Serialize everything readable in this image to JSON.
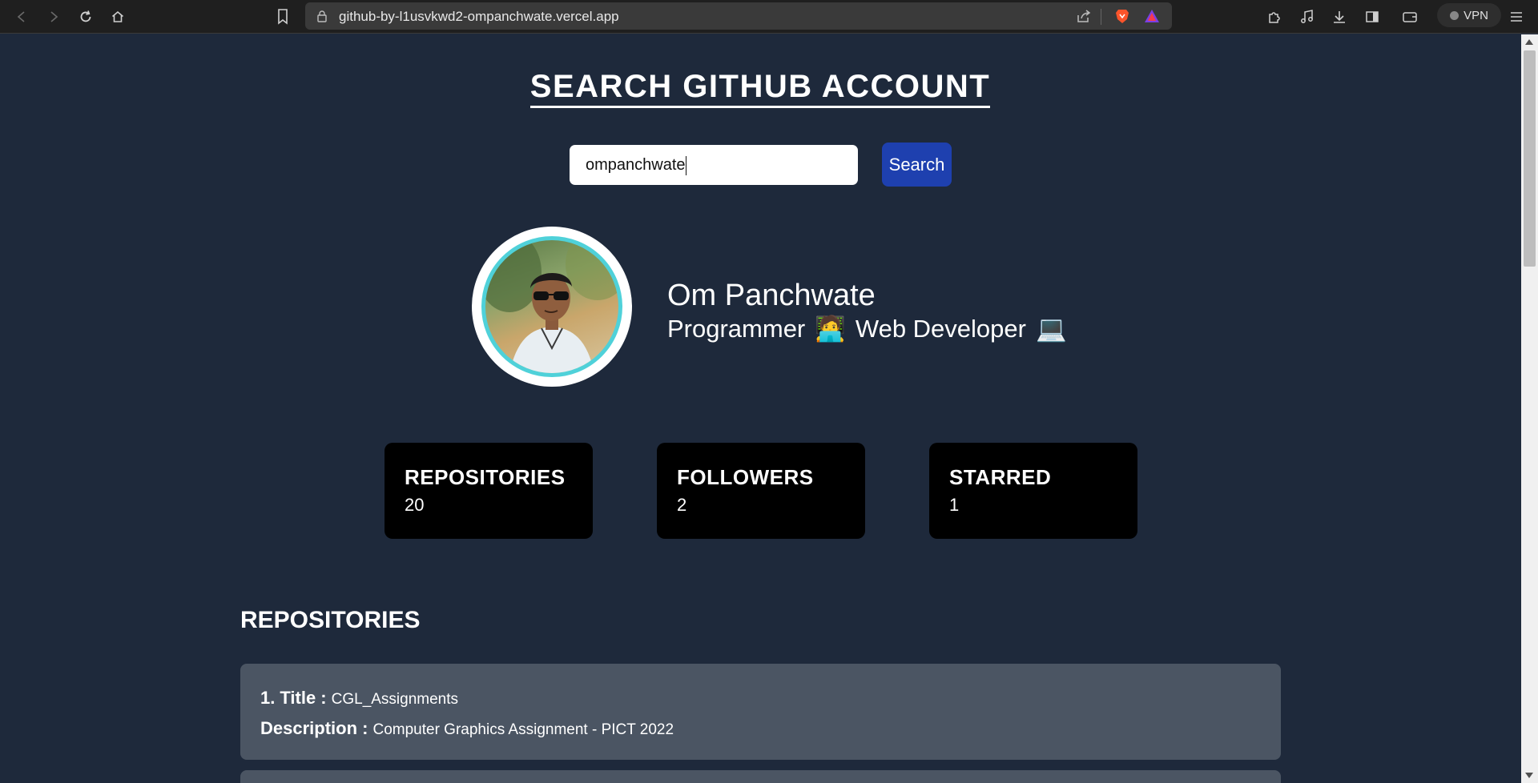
{
  "browser": {
    "url": "github-by-l1usvkwd2-ompanchwate.vercel.app",
    "vpn_label": "VPN"
  },
  "page": {
    "title": "SEARCH GITHUB ACCOUNT",
    "search": {
      "value": "ompanchwate",
      "button_label": "Search"
    },
    "profile": {
      "name": "Om Panchwate",
      "bio_part1": "Programmer",
      "bio_emoji1": "🧑‍💻",
      "bio_part2": "Web Developer",
      "bio_emoji2": "💻"
    },
    "stats": [
      {
        "label": "REPOSITORIES",
        "value": "20"
      },
      {
        "label": "FOLLOWERS",
        "value": "2"
      },
      {
        "label": "STARRED",
        "value": "1"
      }
    ],
    "repositories_heading": "REPOSITORIES",
    "repositories": [
      {
        "index": "1.",
        "title_key": "Title :",
        "title": "CGL_Assignments",
        "desc_key": "Description :",
        "description": "Computer Graphics Assignment - PICT 2022"
      }
    ]
  },
  "colors": {
    "page_bg": "#1e293b",
    "search_button": "#1e40af",
    "avatar_ring": "#4fd1d9",
    "card_bg": "#4b5563",
    "stat_bg": "#000000"
  }
}
